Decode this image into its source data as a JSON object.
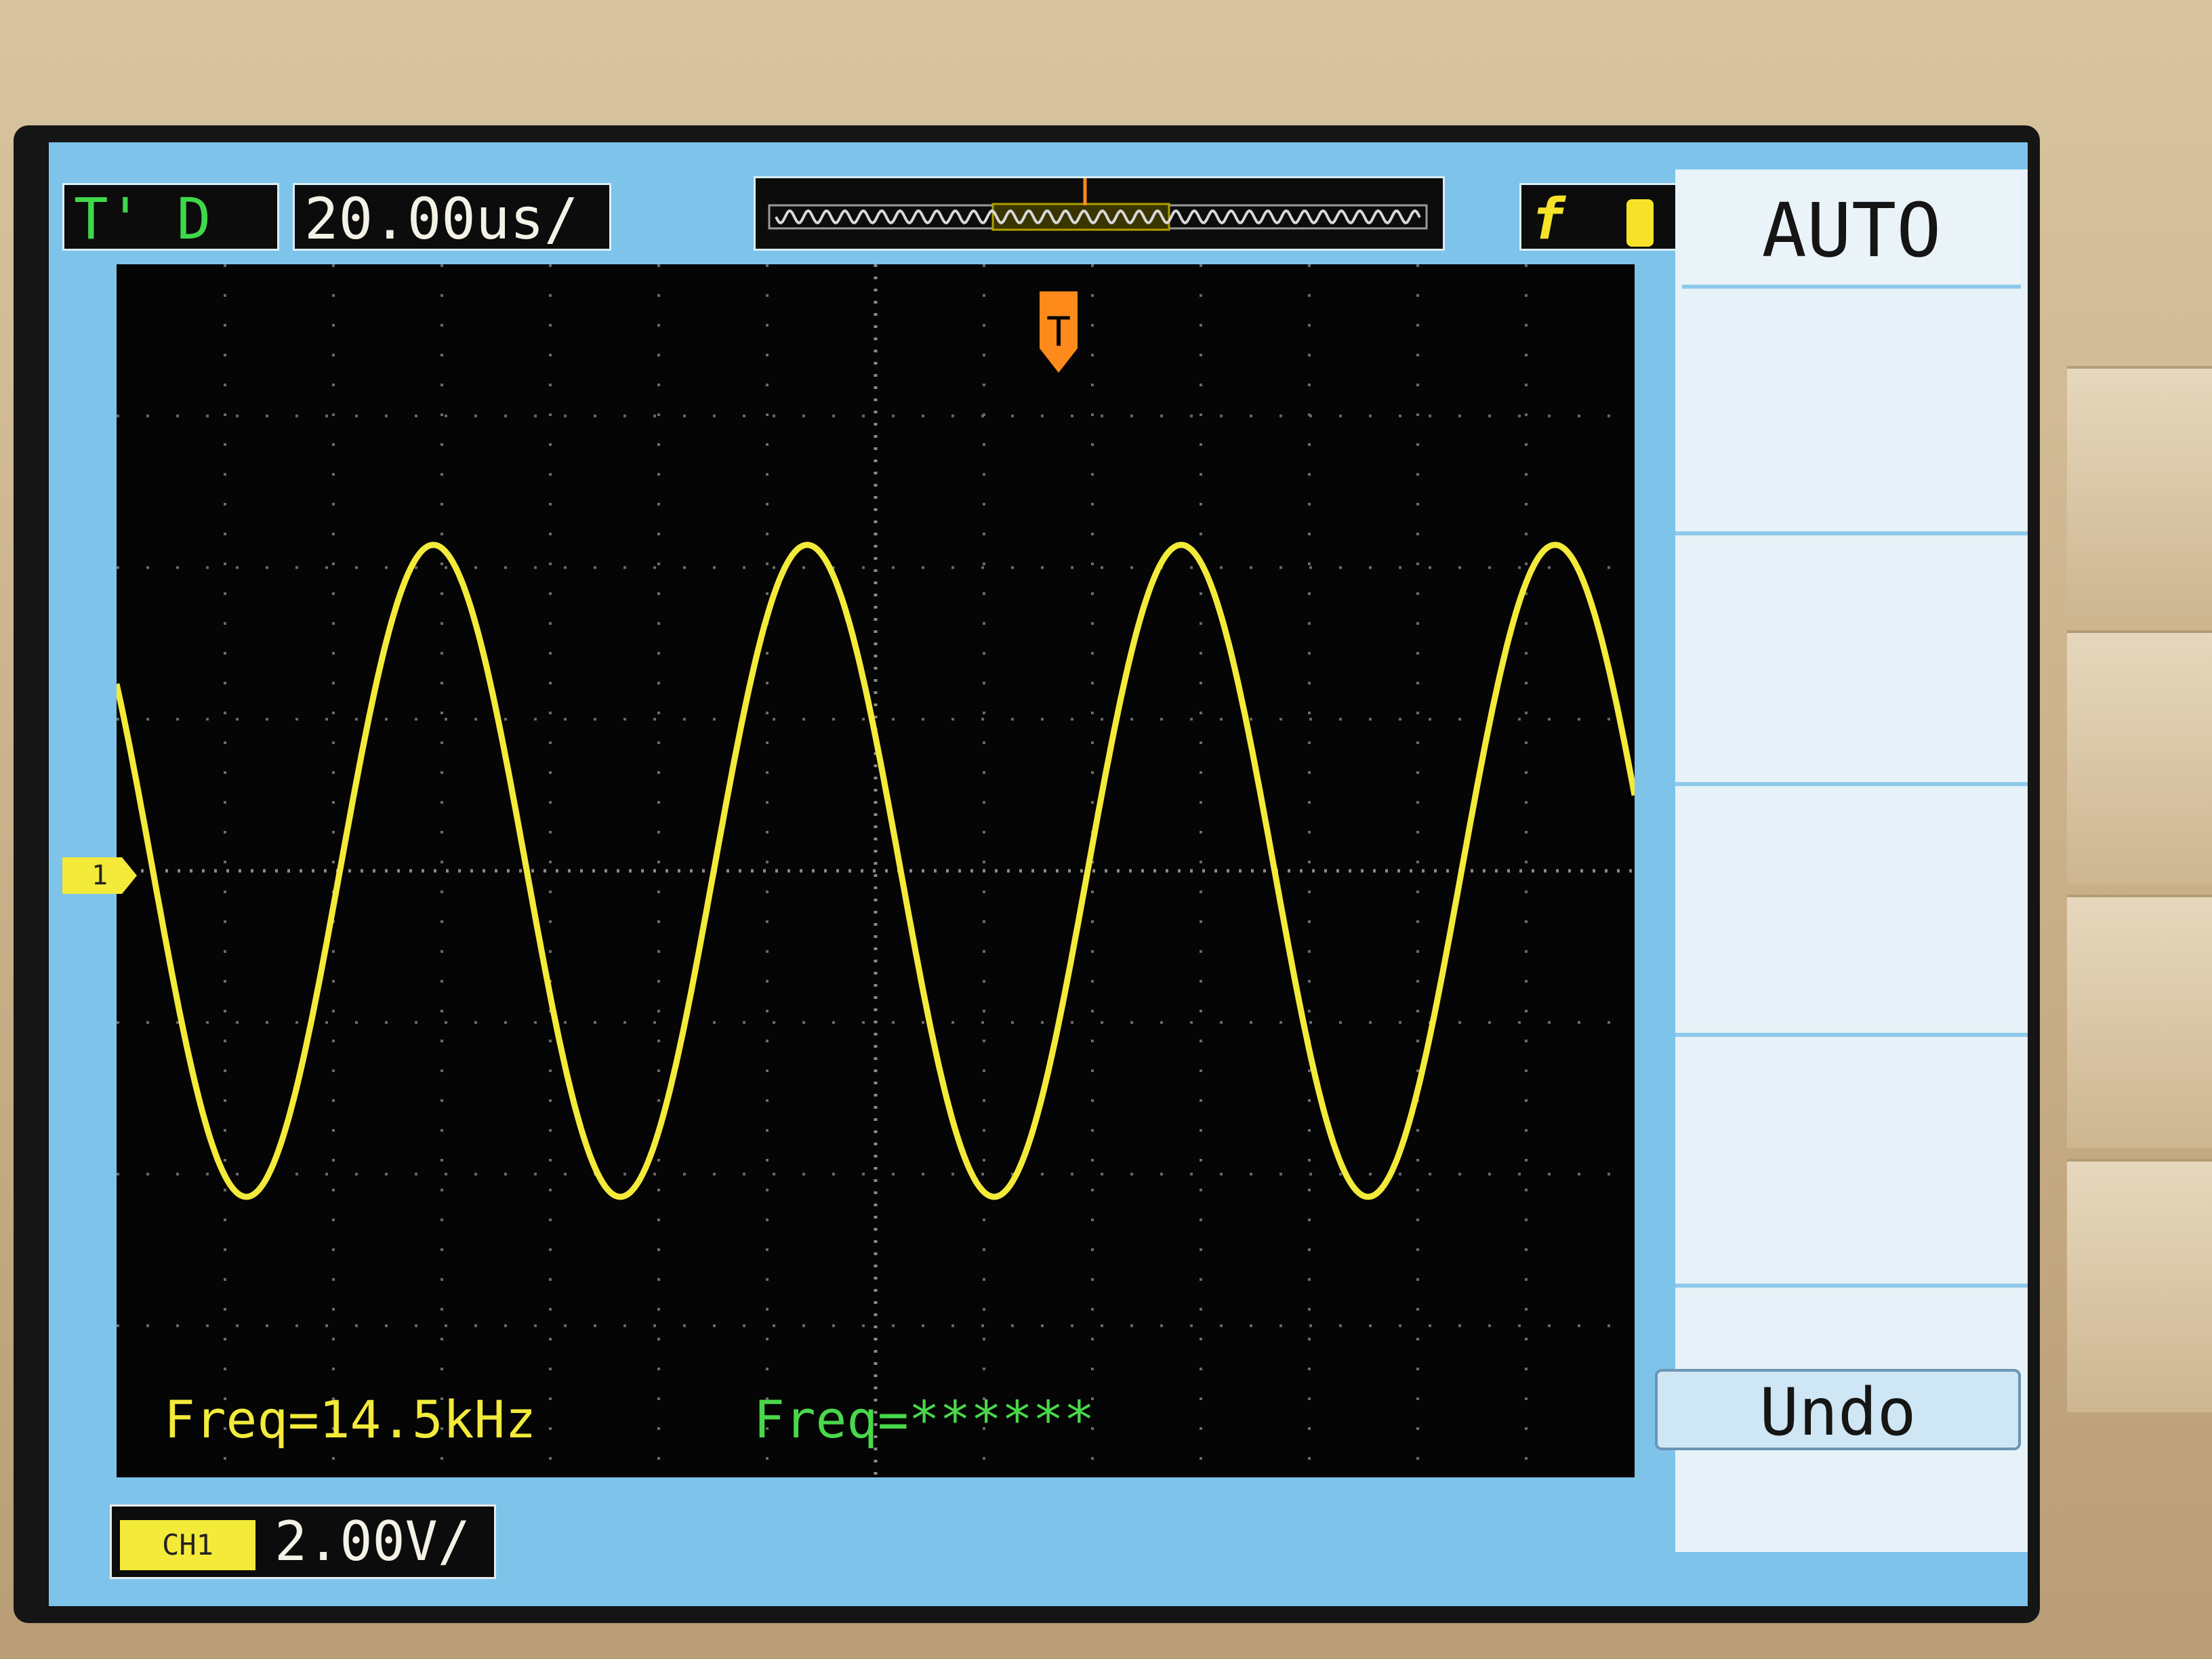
{
  "status_bar": {
    "mode": "T' D",
    "timebase": "20.00us/",
    "trigger_text": "f"
  },
  "softkeys": {
    "auto_label": "AUTO",
    "undo_label": "Undo"
  },
  "measurements": {
    "ch1_freq": "Freq=14.5kHz",
    "ch2_freq": "Freq=******"
  },
  "channel": {
    "marker": "1",
    "tag": "CH1",
    "scale": "2.00V/"
  },
  "trigger_marker": "T",
  "colors": {
    "trace": "#f3ea3a",
    "screen_border": "#7ec3ea",
    "trigger": "#ff8a1c",
    "ch2_text": "#49d84a"
  },
  "chart_data": {
    "type": "line",
    "title": "",
    "xlabel": "",
    "ylabel": "",
    "x_per_div_us": 20,
    "y_per_div_V": 2,
    "x_divisions": 14,
    "y_divisions": 8,
    "xlim_us": [
      -140,
      140
    ],
    "ylim_V": [
      -8,
      8
    ],
    "series": [
      {
        "frequency_khz": 14.5,
        "amplitude_V": 4.3,
        "offset_V": 0,
        "phase_at_left_edge_deg": 145
      }
    ]
  }
}
